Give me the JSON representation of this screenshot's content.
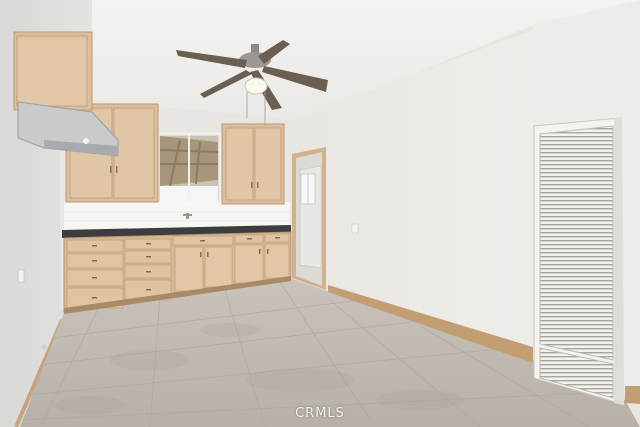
{
  "photo": {
    "watermark": "CRMLS"
  }
}
